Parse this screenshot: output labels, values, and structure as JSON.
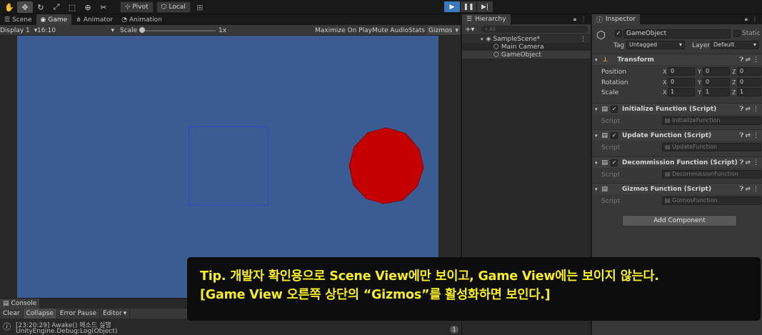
{
  "toolbar": {
    "pivot_label": "Pivot",
    "local_label": "Local",
    "tools": [
      "hand-tool-icon",
      "move-tool-icon",
      "rotate-tool-icon",
      "scale-tool-icon",
      "rect-tool-icon",
      "transform-tool-icon",
      "custom-tool-icon"
    ]
  },
  "game": {
    "tabs": [
      {
        "label": "Scene",
        "icon": "scene-icon"
      },
      {
        "label": "Game",
        "icon": "game-icon"
      },
      {
        "label": "Animator",
        "icon": "animator-icon"
      },
      {
        "label": "Animation",
        "icon": "animation-icon"
      }
    ],
    "display": "Display 1",
    "aspect": "16:10",
    "scale_label": "Scale",
    "scale_value": "1x",
    "maximize": "Maximize On Play",
    "mute": "Mute Audio",
    "stats": "Stats",
    "gizmos": "Gizmos",
    "background_color": "#3b5c93",
    "sphere_color": "#c40000"
  },
  "hierarchy": {
    "title": "Hierarchy",
    "search_placeholder": "All",
    "scene": "SampleScene*",
    "items": [
      "Main Camera",
      "GameObject"
    ]
  },
  "inspector": {
    "title": "Inspector",
    "object_name": "GameObject",
    "static_label": "Static",
    "tag_label": "Tag",
    "tag_value": "Untagged",
    "layer_label": "Layer",
    "layer_value": "Default",
    "transform": {
      "title": "Transform",
      "position_label": "Position",
      "rotation_label": "Rotation",
      "scale_label": "Scale",
      "position": [
        "0",
        "0",
        "0"
      ],
      "rotation": [
        "0",
        "0",
        "0"
      ],
      "scale": [
        "1",
        "1",
        "1"
      ],
      "axes": [
        "X",
        "Y",
        "Z"
      ]
    },
    "scripts": [
      {
        "title": "Initialize Function (Script)",
        "field_label": "Script",
        "value": "InitializeFunction",
        "enabled": true
      },
      {
        "title": "Update Function (Script)",
        "field_label": "Script",
        "value": "UpdateFunction",
        "enabled": true
      },
      {
        "title": "Decommission Function (Script)",
        "field_label": "Script",
        "value": "DecommissionFunction",
        "enabled": true
      },
      {
        "title": "Gizmos Function (Script)",
        "field_label": "Script",
        "value": "GizmosFunction",
        "enabled": false
      }
    ],
    "add_component": "Add Component"
  },
  "console": {
    "title": "Console",
    "clear": "Clear",
    "collapse": "Collapse",
    "error_pause": "Error Pause",
    "editor": "Editor",
    "log_line1": "[23:20:29] Awake() 메소드 실행",
    "log_line2": "UnityEngine.Debug:Log(Object)",
    "count": "1"
  },
  "caption": {
    "line1": "Tip. 개발자 확인용으로 Scene View에만 보이고, Game View에는 보이지 않는다.",
    "line2": "[Game View 오른쪽 상단의 “Gizmos”를 활성화하면 보인다.]"
  }
}
